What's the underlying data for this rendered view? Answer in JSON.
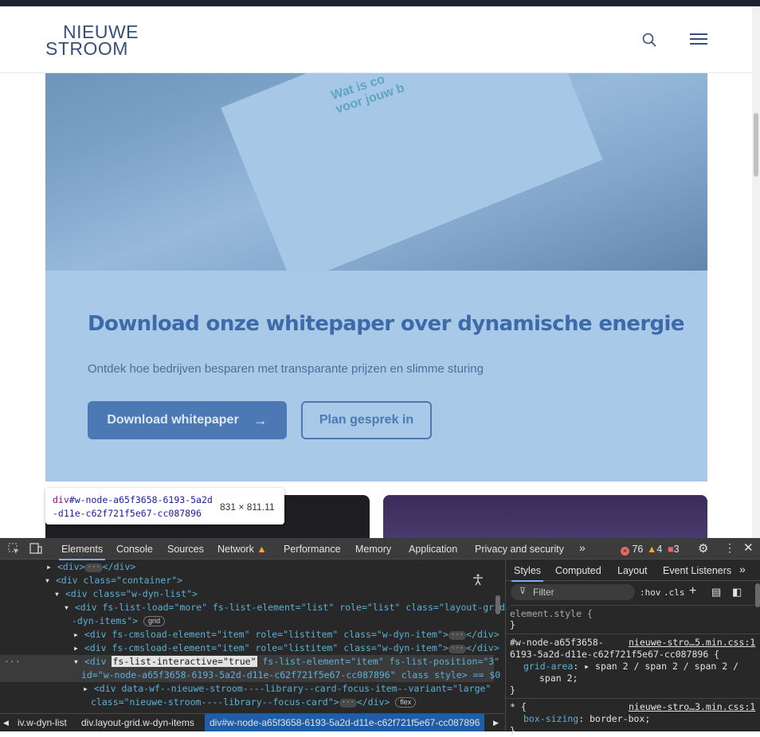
{
  "site": {
    "logo_line1": "NIEUWE",
    "logo_line2": "STROOM",
    "whitepaper_title": "Download onze whitepaper over dynamische energie",
    "whitepaper_subtitle": "Ontdek hoe bedrijven besparen met transparante prijzen en slimme sturing",
    "primary_button": "Download whitepaper",
    "secondary_button": "Plan gesprek in"
  },
  "inspect_tooltip": {
    "tag": "div",
    "id": "#w-node-a65f3658-6193-5a2d-d11e-c62f721f5e67-cc087896",
    "size": "831 × 811.11"
  },
  "devtools": {
    "tabs": [
      "Elements",
      "Console",
      "Sources",
      "Network",
      "Performance",
      "Memory",
      "Application",
      "Privacy and security"
    ],
    "active_tab": "Elements",
    "more_tabs": "»",
    "errors": "76",
    "warnings": "4",
    "issues": "3",
    "dom_lines": [
      {
        "open": "<div>",
        "close": "</div>"
      },
      {
        "text": "<div class=\"container\">"
      },
      {
        "text": "<div class=\"w-dyn-list\">"
      },
      {
        "text": "<div fs-list-load=\"more\" fs-list-element=\"list\" role=\"list\" class=\"layout-grid w"
      },
      {
        "text": "-dyn-items\">",
        "badge": "grid"
      },
      {
        "text": "<div fs-cmsload-element=\"item\" role=\"listitem\" class=\"w-dyn-item\">"
      },
      {
        "text": "<div fs-cmsload-element=\"item\" role=\"listitem\" class=\"w-dyn-item\">"
      },
      {
        "text": "<div fs-list-interactive=\"true\" fs-list-element=\"item\" fs-list-position=\"3\""
      },
      {
        "text": "id=\"w-node-a65f3658-6193-5a2d-d11e-c62f721f5e67-cc087896\" class style> == $0"
      },
      {
        "text": "<div data-wf--nieuwe-stroom----library--card-focus-item--variant=\"large\""
      },
      {
        "text": "class=\"nieuwe-stroom----library--focus-card\">",
        "badge": "flex"
      }
    ],
    "styles_tabs": [
      "Styles",
      "Computed",
      "Layout",
      "Event Listeners"
    ],
    "filter_placeholder": "Filter",
    "hov": ":hov",
    "cls": ".cls",
    "element_style": "element.style {",
    "rule1_selector": "#w-node-a65f3658-",
    "rule1_selector2": "6193-5a2d-d11e-c62f721f5e67-cc087896 {",
    "rule1_source": "nieuwe-stro…5.min.css:1",
    "rule1_prop": "grid-area",
    "rule1_value": "span 2 / span 2 / span 2 /",
    "rule1_value2": "span 2;",
    "rule2_selector": "* {",
    "rule2_source": "nieuwe-stro…3.min.css:1",
    "rule2_prop": "box-sizing",
    "rule2_value": "border-box;",
    "breadcrumbs": [
      "iv.w-dyn-list",
      "div.layout-grid.w-dyn-items",
      "div#w-node-a65f3658-6193-5a2d-d11e-c62f721f5e67-cc087896"
    ]
  }
}
